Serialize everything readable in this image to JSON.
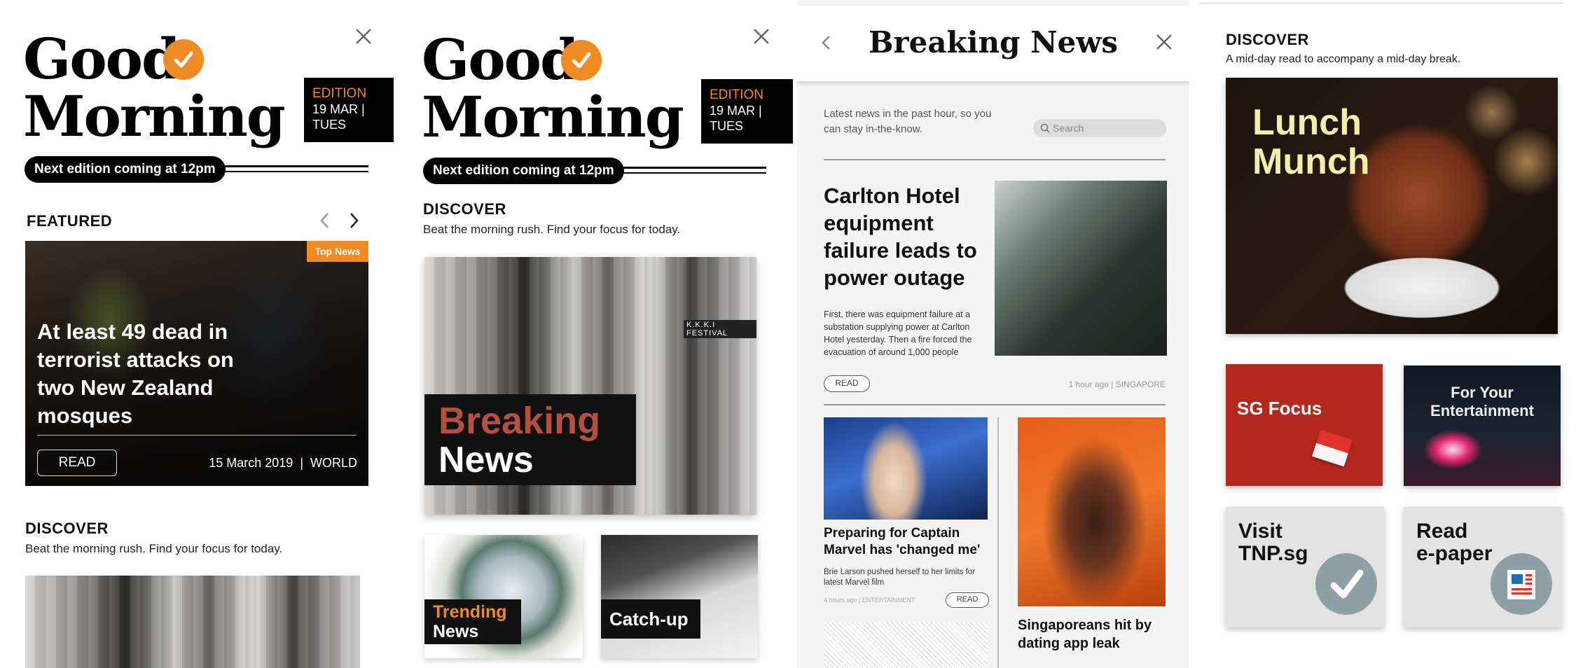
{
  "colors": {
    "accent": "#f08a24",
    "black": "#000000",
    "sg_red": "#b5281e",
    "tile_gray": "#e3e3e3",
    "check_gray": "#8e9fa6"
  },
  "screen1": {
    "logo_line1": "Good",
    "logo_line2": "Morning",
    "edition": {
      "label": "EDITION",
      "date": "19 MAR |",
      "day": "TUES"
    },
    "next_edition": "Next edition coming at 12pm",
    "featured": {
      "title": "FEATURED",
      "badge": "Top News",
      "headline": "At least 49 dead in terrorist attacks on two New Zealand mosques",
      "read_label": "READ",
      "meta": "15 March 2019  |  WORLD"
    },
    "discover": {
      "title": "DISCOVER",
      "subtitle": "Beat the morning rush. Find your focus for today."
    }
  },
  "screen2": {
    "logo_line1": "Good",
    "logo_line2": "Morning",
    "edition": {
      "label": "EDITION",
      "date": "19 MAR |",
      "day": "TUES"
    },
    "next_edition": "Next edition coming at 12pm",
    "discover": {
      "title": "DISCOVER",
      "subtitle": "Beat the morning rush. Find your focus for today."
    },
    "hero_card": {
      "line1": "Breaking",
      "line2": "News",
      "newspaper_text": "K.K.K.I FESTIVAL"
    },
    "tiles": [
      {
        "line1": "Trending",
        "line2": "News"
      },
      {
        "line1": "Catch-up"
      }
    ]
  },
  "screen3": {
    "title": "Breaking News",
    "intro": "Latest news in the past hour, so you can stay in-the-know.",
    "search_placeholder": "Search",
    "lead": {
      "headline": "Carlton Hotel equipment failure leads to power outage",
      "summary": "First, there was equipment failure at a substation supplying power at Carlton Hotel yesterday. Then a fire forced the evacuation of around 1,000 people",
      "read_label": "READ",
      "meta": "1 hour ago | SINGAPORE"
    },
    "story2": {
      "headline": "Preparing for Captain Marvel has 'changed me'",
      "summary": "Brie Larson pushed herself to her limits for latest Marvel film",
      "meta": "4 hours ago | ENTERTAINMENT",
      "read_label": "READ"
    },
    "story3": {
      "headline": "Singaporeans hit by dating app leak"
    }
  },
  "screen4": {
    "discover": {
      "title": "DISCOVER",
      "subtitle": "A mid-day read to accompany a mid-day break."
    },
    "hero": {
      "line1": "Lunch",
      "line2": "Munch"
    },
    "tiles": [
      {
        "label": "SG Focus"
      },
      {
        "line1": "For Your",
        "line2": "Entertainment"
      },
      {
        "line1": "Visit",
        "line2": "TNP.sg"
      },
      {
        "line1": "Read",
        "line2": "e-paper"
      }
    ]
  }
}
